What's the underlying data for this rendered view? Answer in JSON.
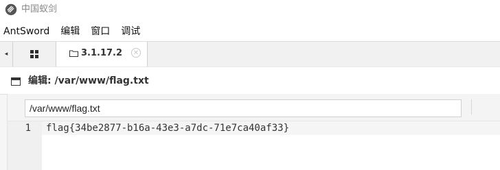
{
  "window": {
    "title": "中国蚁剑",
    "icon": "antsword-logo-icon"
  },
  "menu": {
    "items": [
      "AntSword",
      "编辑",
      "窗口",
      "调试"
    ]
  },
  "tabs": {
    "scroll_left_glyph": "◂",
    "home_icon": "grid-icon",
    "active": {
      "icon": "folder-icon",
      "label": "3.1.17.2",
      "close_glyph": "✕"
    }
  },
  "editor_panel": {
    "title": "编辑: /var/www/flag.txt",
    "path_value": "/var/www/flag.txt",
    "lines": [
      {
        "number": "1",
        "text": "flag{34be2877-b16a-43e3-a7dc-71e7ca40af33}"
      }
    ]
  },
  "colors": {
    "tabbar_bg": "#f1f1f1",
    "gutter_bg": "#f0f0f0",
    "title_text": "#8a8a8a"
  }
}
